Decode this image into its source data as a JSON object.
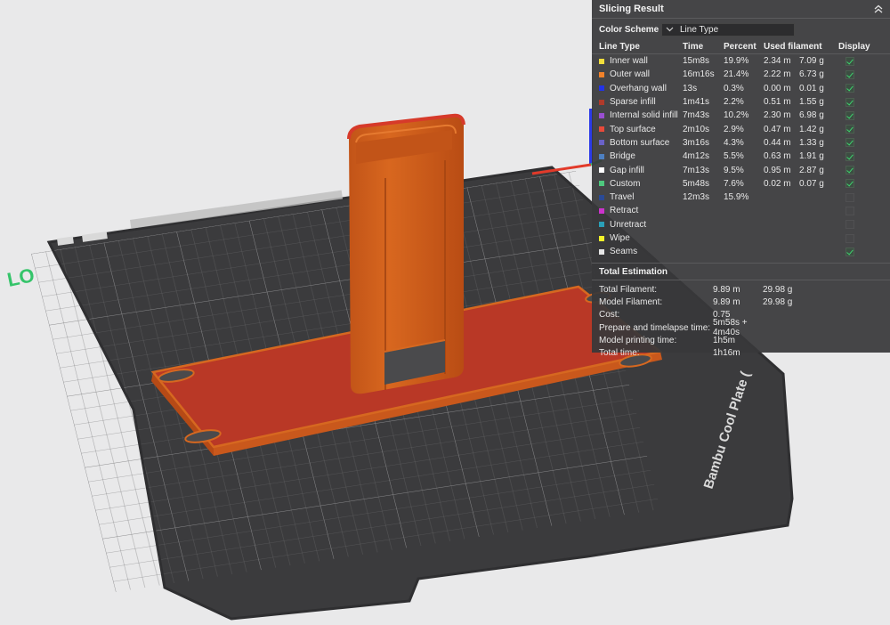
{
  "viewport": {
    "bed_label": "Bambu Cool Plate (",
    "logo_text": "LO"
  },
  "panel": {
    "title": "Slicing Result",
    "color_scheme_label": "Color Scheme",
    "color_scheme_value": "Line Type",
    "columns": [
      "Line Type",
      "Time",
      "Percent",
      "Used filament",
      "Display"
    ],
    "rows": [
      {
        "type": "Inner wall",
        "color": "#f2de3c",
        "time": "15m8s",
        "percent": "19.9%",
        "length": "2.34 m",
        "weight": "7.09 g",
        "display": true
      },
      {
        "type": "Outer wall",
        "color": "#f2822a",
        "time": "16m16s",
        "percent": "21.4%",
        "length": "2.22 m",
        "weight": "6.73 g",
        "display": true
      },
      {
        "type": "Overhang wall",
        "color": "#2233e8",
        "time": "13s",
        "percent": "0.3%",
        "length": "0.00 m",
        "weight": "0.01 g",
        "display": true
      },
      {
        "type": "Sparse infill",
        "color": "#b03a2a",
        "time": "1m41s",
        "percent": "2.2%",
        "length": "0.51 m",
        "weight": "1.55 g",
        "display": true
      },
      {
        "type": "Internal solid infill",
        "color": "#9a4ed2",
        "time": "7m43s",
        "percent": "10.2%",
        "length": "2.30 m",
        "weight": "6.98 g",
        "display": true
      },
      {
        "type": "Top surface",
        "color": "#e84a3a",
        "time": "2m10s",
        "percent": "2.9%",
        "length": "0.47 m",
        "weight": "1.42 g",
        "display": true
      },
      {
        "type": "Bottom surface",
        "color": "#6a62c8",
        "time": "3m16s",
        "percent": "4.3%",
        "length": "0.44 m",
        "weight": "1.33 g",
        "display": true
      },
      {
        "type": "Bridge",
        "color": "#4d80c2",
        "time": "4m12s",
        "percent": "5.5%",
        "length": "0.63 m",
        "weight": "1.91 g",
        "display": true
      },
      {
        "type": "Gap infill",
        "color": "#ffffff",
        "time": "7m13s",
        "percent": "9.5%",
        "length": "0.95 m",
        "weight": "2.87 g",
        "display": true
      },
      {
        "type": "Custom",
        "color": "#4ec87e",
        "time": "5m48s",
        "percent": "7.6%",
        "length": "0.02 m",
        "weight": "0.07 g",
        "display": true
      },
      {
        "type": "Travel",
        "color": "#2a4a96",
        "time": "12m3s",
        "percent": "15.9%",
        "length": "",
        "weight": "",
        "display": false
      },
      {
        "type": "Retract",
        "color": "#cc33cc",
        "time": "",
        "percent": "",
        "length": "",
        "weight": "",
        "display": false
      },
      {
        "type": "Unretract",
        "color": "#2aa0b8",
        "time": "",
        "percent": "",
        "length": "",
        "weight": "",
        "display": false
      },
      {
        "type": "Wipe",
        "color": "#f2f22a",
        "time": "",
        "percent": "",
        "length": "",
        "weight": "",
        "display": false
      },
      {
        "type": "Seams",
        "color": "#e6e6e6",
        "time": "",
        "percent": "",
        "length": "",
        "weight": "",
        "display": true
      }
    ],
    "total_title": "Total Estimation",
    "estimation": [
      {
        "label": "Total Filament:",
        "v1": "9.89 m",
        "v2": "29.98 g"
      },
      {
        "label": "Model Filament:",
        "v1": "9.89 m",
        "v2": "29.98 g"
      },
      {
        "label": "Cost:",
        "v1": "0.75",
        "v2": ""
      },
      {
        "label": "Prepare and timelapse time:",
        "v1": "5m58s + 4m40s",
        "v2": ""
      },
      {
        "label": "Model printing time:",
        "v1": "1h5m",
        "v2": ""
      },
      {
        "label": "Total time:",
        "v1": "1h16m",
        "v2": ""
      }
    ]
  }
}
